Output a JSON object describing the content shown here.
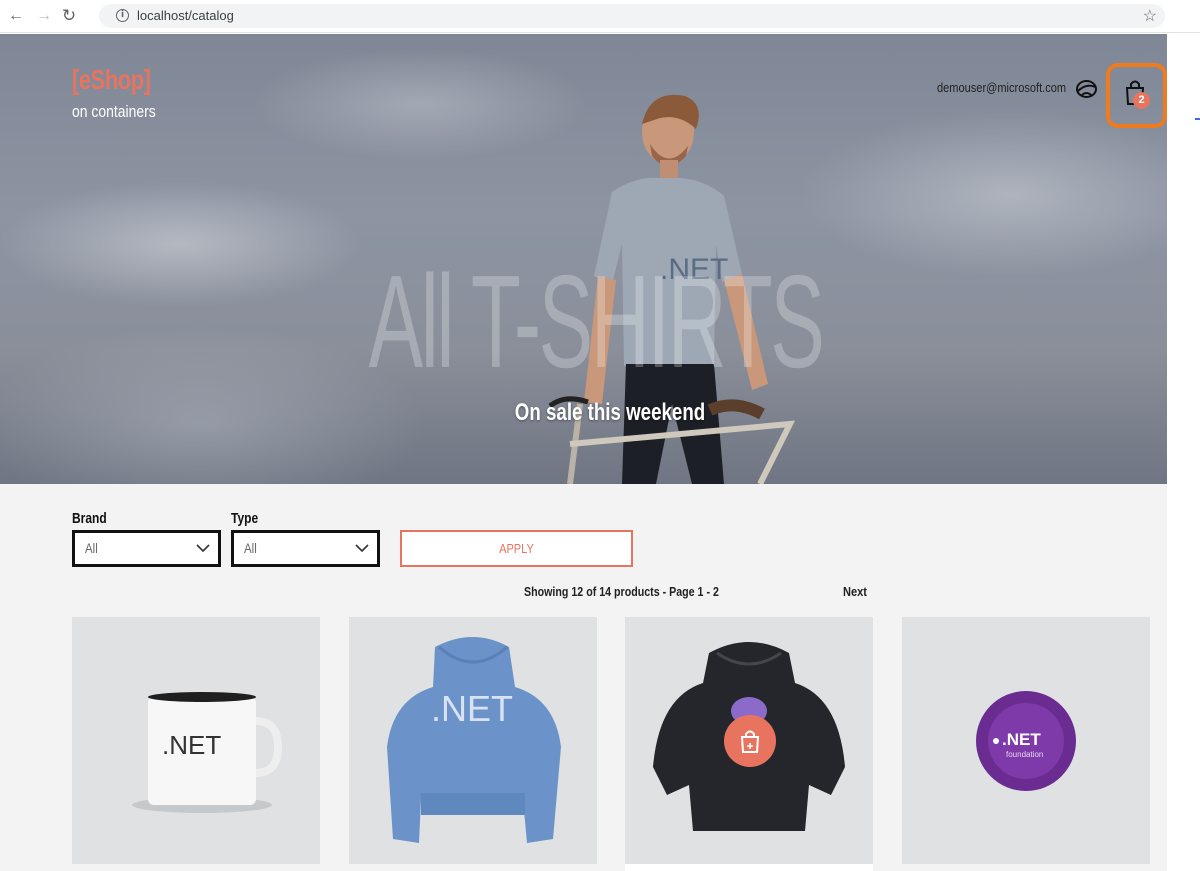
{
  "browser": {
    "url": "localhost/catalog",
    "back_icon": "arrow-left",
    "forward_icon": "arrow-right",
    "reload_icon": "reload",
    "star_icon": "star"
  },
  "header": {
    "logo_main": "[eShop]",
    "logo_sub": "on containers",
    "user_email": "demouser@microsoft.com",
    "cart_count": "2"
  },
  "hero": {
    "title": "All T-SHIRTS",
    "subtitle": "On sale this weekend",
    "shirt_text": ".NET"
  },
  "filters": {
    "brand_label": "Brand",
    "brand_value": "All",
    "type_label": "Type",
    "type_value": "All",
    "apply_label": "APPLY"
  },
  "pager": {
    "summary": "Showing 12 of 14 products - Page 1 - 2",
    "next_label": "Next"
  },
  "products": [
    {
      "name": "mug",
      "text": ".NET"
    },
    {
      "name": "blue-hoodie",
      "text": ".NET"
    },
    {
      "name": "black-hoodie",
      "text": ""
    },
    {
      "name": "foundation-frisbee",
      "text": ".NET",
      "subtext": "foundation"
    }
  ],
  "colors": {
    "accent": "#e8745f",
    "highlight_ring": "#f07b1e",
    "content_bg": "#f3f3f3"
  }
}
